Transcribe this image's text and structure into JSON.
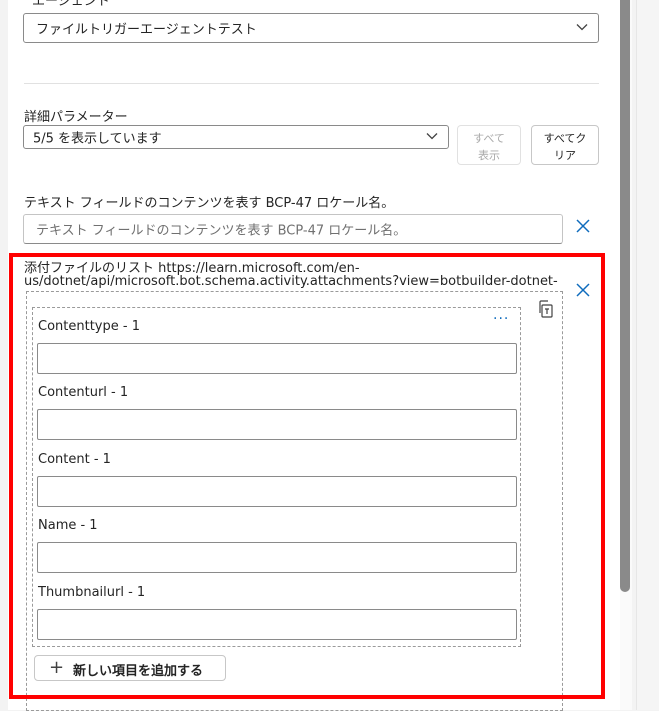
{
  "agent": {
    "label": "エージェント",
    "selected": "ファイルトリガーエージェントテスト"
  },
  "advanced": {
    "label": "詳細パラメーター",
    "selected": "5/5 を表示しています",
    "show_all_button": "すべて表示",
    "clear_all_button": "すべてクリア"
  },
  "locale_field": {
    "label": "テキスト フィールドのコンテンツを表す BCP-47 ロケール名。",
    "placeholder": "テキスト フィールドのコンテンツを表す BCP-47 ロケール名。"
  },
  "attachments": {
    "label_line1": "添付ファイルのリスト https://learn.microsoft.com/en-",
    "label_line2": "us/dotnet/api/microsoft.bot.schema.activity.attachments?view=botbuilder-dotnet-",
    "fields": [
      {
        "label": "Contenttype - 1",
        "value": ""
      },
      {
        "label": "Contenturl - 1",
        "value": ""
      },
      {
        "label": "Content - 1",
        "value": ""
      },
      {
        "label": "Name - 1",
        "value": ""
      },
      {
        "label": "Thumbnailurl - 1",
        "value": ""
      }
    ],
    "more_symbol": "···",
    "add_item_label": "新しい項目を追加する"
  },
  "colors": {
    "accent": "#0f6cbd",
    "highlight": "#ff0000"
  }
}
